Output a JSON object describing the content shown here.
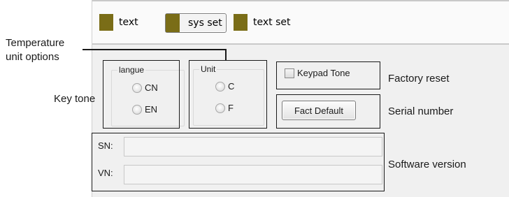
{
  "tabs": [
    {
      "label": "text",
      "active": false
    },
    {
      "label": "sys set",
      "active": true
    },
    {
      "label": "text set",
      "active": false
    }
  ],
  "language_group": {
    "title": "langue",
    "options": [
      {
        "label": "CN",
        "selected": false
      },
      {
        "label": "EN",
        "selected": false
      }
    ]
  },
  "unit_group": {
    "title": "Unit",
    "options": [
      {
        "label": "C",
        "selected": false
      },
      {
        "label": "F",
        "selected": false
      }
    ]
  },
  "keypad_tone": {
    "label": "Keypad Tone",
    "checked": false
  },
  "fact_default": {
    "label": "Fact Default"
  },
  "fields": {
    "sn": {
      "label": "SN:",
      "value": ""
    },
    "vn": {
      "label": "VN:",
      "value": ""
    }
  },
  "annotations": {
    "temperature_unit": "Temperature\nunit options",
    "key_tone": "Key tone",
    "factory_reset": "Factory reset",
    "serial_number": "Serial number",
    "software_version": "Software version"
  },
  "colors": {
    "tab_swatch": "#7a6d17",
    "panel_bg": "#f0f0f0",
    "callout": "#1a1a1a"
  }
}
